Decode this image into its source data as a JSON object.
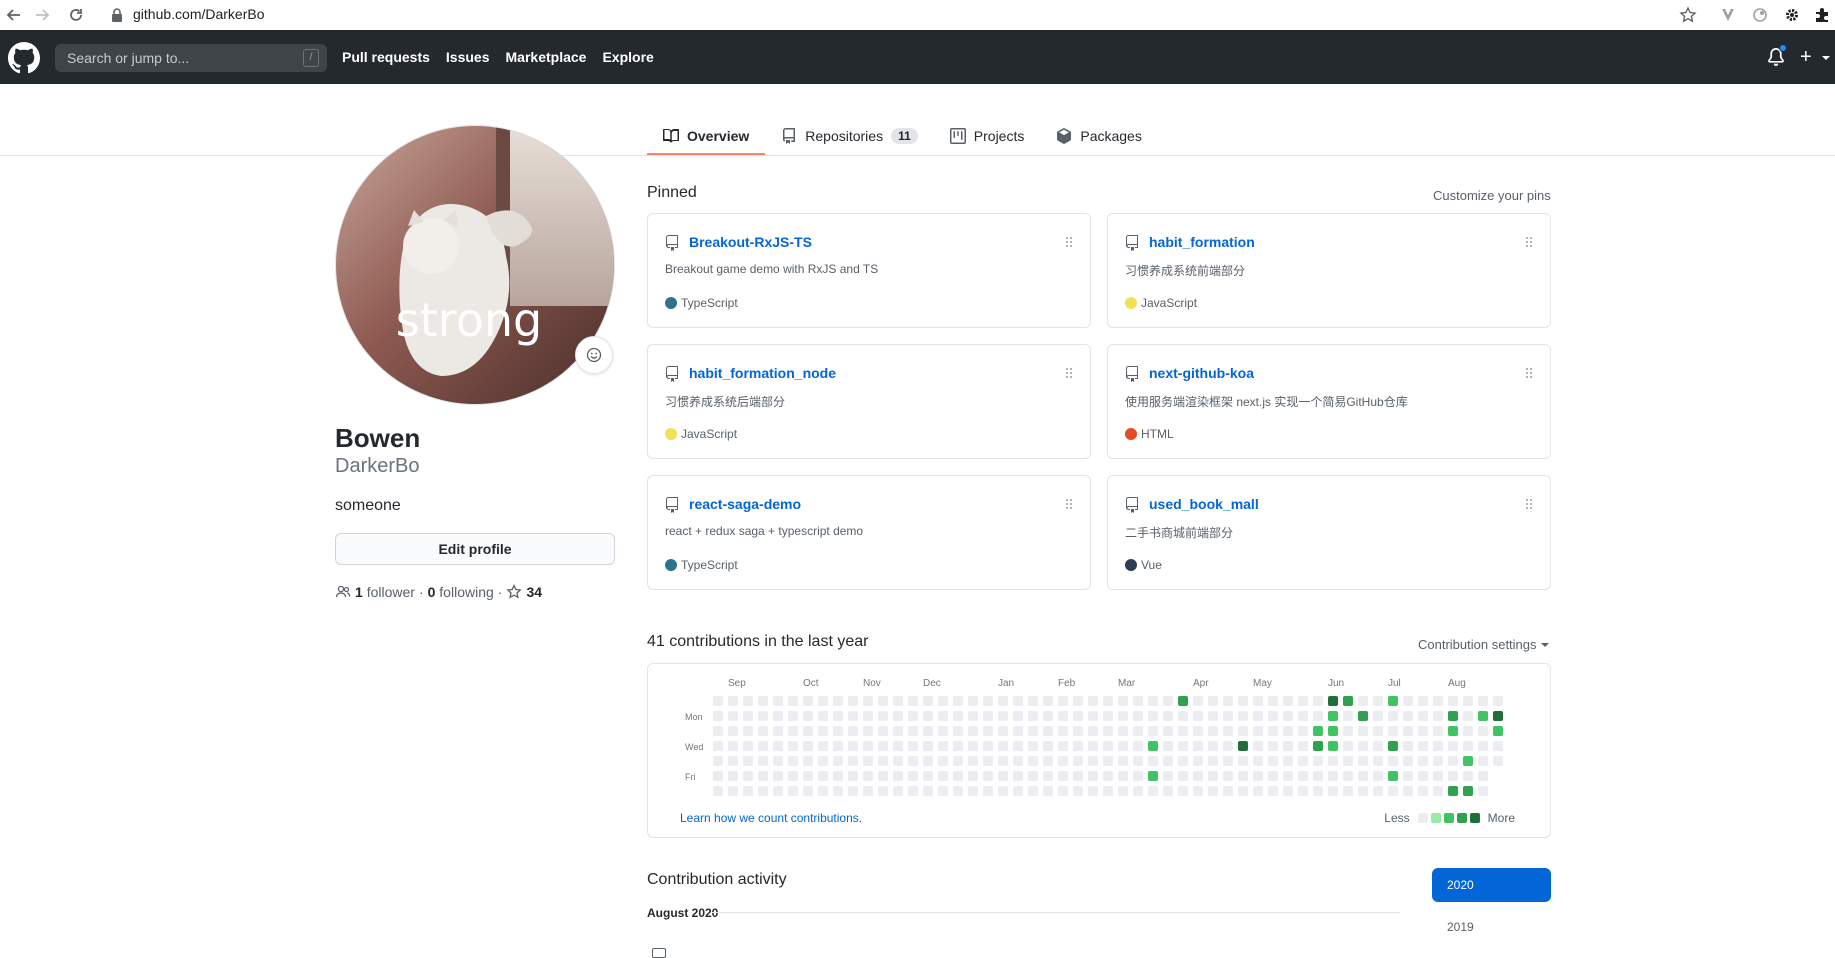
{
  "browser": {
    "url": "github.com/DarkerBo",
    "icons": [
      "back-arrow",
      "forward-arrow",
      "reload",
      "lock",
      "star",
      "extension-v",
      "extension-circle",
      "gear",
      "puzzle"
    ]
  },
  "header": {
    "search_placeholder": "Search or jump to...",
    "search_shortcut": "/",
    "nav": [
      "Pull requests",
      "Issues",
      "Marketplace",
      "Explore"
    ],
    "plus_label": "+"
  },
  "tabs": [
    {
      "label": "Overview",
      "icon": "book-icon",
      "active": true
    },
    {
      "label": "Repositories",
      "icon": "repo-icon",
      "count": "11"
    },
    {
      "label": "Projects",
      "icon": "project-icon"
    },
    {
      "label": "Packages",
      "icon": "package-icon"
    }
  ],
  "profile": {
    "avatar_text": "strong",
    "name": "Bowen",
    "login": "DarkerBo",
    "bio": "someone",
    "edit_label": "Edit profile",
    "followers_count": "1",
    "followers_label": "follower",
    "sep1": "·",
    "following_count": "0",
    "following_label": "following",
    "sep2": "·",
    "stars": "34"
  },
  "pinned": {
    "title": "Pinned",
    "customize": "Customize your pins",
    "repos": [
      {
        "name": "Breakout-RxJS-TS",
        "desc": "Breakout game demo with RxJS and TS",
        "lang": "TypeScript",
        "color": "#2b7489"
      },
      {
        "name": "habit_formation",
        "desc": "习惯养成系统前端部分",
        "lang": "JavaScript",
        "color": "#f1e05a"
      },
      {
        "name": "habit_formation_node",
        "desc": "习惯养成系统后端部分",
        "lang": "JavaScript",
        "color": "#f1e05a"
      },
      {
        "name": "next-github-koa",
        "desc": "使用服务端渲染框架 next.js 实现一个简易GitHub仓库",
        "lang": "HTML",
        "color": "#e34c26"
      },
      {
        "name": "react-saga-demo",
        "desc": "react + redux saga + typescript demo",
        "lang": "TypeScript",
        "color": "#2b7489"
      },
      {
        "name": "used_book_mall",
        "desc": "二手书商城前端部分",
        "lang": "Vue",
        "color": "#2c3e50"
      }
    ]
  },
  "contributions": {
    "title": "41 contributions in the last year",
    "settings_label": "Contribution settings",
    "months": [
      "Sep",
      "Oct",
      "Nov",
      "Dec",
      "Jan",
      "Feb",
      "Mar",
      "Apr",
      "May",
      "Jun",
      "Jul",
      "Aug"
    ],
    "days": [
      "Mon",
      "Wed",
      "Fri"
    ],
    "learn_link": "Learn how we count contributions.",
    "legend_less": "Less",
    "legend_more": "More",
    "colors": [
      "#ebedf0",
      "#9be9a8",
      "#40c463",
      "#30a14e",
      "#216e39"
    ]
  },
  "activity": {
    "title": "Contribution activity",
    "month": "August 2020",
    "years": [
      "2020",
      "2019"
    ]
  }
}
